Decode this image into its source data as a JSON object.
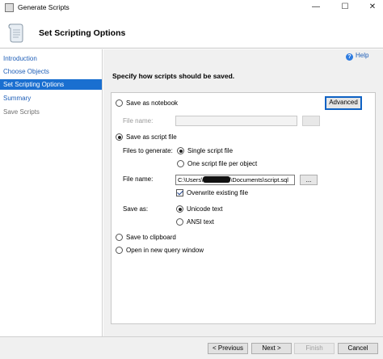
{
  "window": {
    "title": "Generate Scripts",
    "controls": {
      "minimize": "—",
      "maximize": "☐",
      "close": "✕"
    }
  },
  "header": {
    "title": "Set Scripting Options",
    "icon": "scroll-icon"
  },
  "sidebar": {
    "items": [
      {
        "label": "Introduction",
        "state": "link"
      },
      {
        "label": "Choose Objects",
        "state": "link"
      },
      {
        "label": "Set Scripting Options",
        "state": "active"
      },
      {
        "label": "Summary",
        "state": "link"
      },
      {
        "label": "Save Scripts",
        "state": "disabled"
      }
    ]
  },
  "main": {
    "help_label": "Help",
    "help_glyph": "?",
    "instruction": "Specify how scripts should be saved.",
    "options": {
      "notebook_label": "Save as notebook",
      "advanced_label": "Advanced",
      "notebook_file_name_label": "File name:",
      "notebook_file_name_value": "",
      "script_file_label": "Save as script file",
      "files_to_generate_label": "Files to generate:",
      "single_file_label": "Single script file",
      "one_per_object_label": "One script file per object",
      "file_name_label": "File name:",
      "file_path_prefix": "C:\\Users\\",
      "file_path_suffix": "\\Documents\\script.sql",
      "browse_label": "...",
      "overwrite_label": "Overwrite existing file",
      "save_as_label": "Save as:",
      "unicode_label": "Unicode text",
      "ansi_label": "ANSI text",
      "clipboard_label": "Save to clipboard",
      "query_window_label": "Open in new query window"
    }
  },
  "footer": {
    "previous": "< Previous",
    "next": "Next >",
    "finish": "Finish",
    "cancel": "Cancel"
  },
  "colors": {
    "accent": "#1a6fd0",
    "link": "#1f5fb8",
    "panel_bg": "#f0f0f0"
  }
}
